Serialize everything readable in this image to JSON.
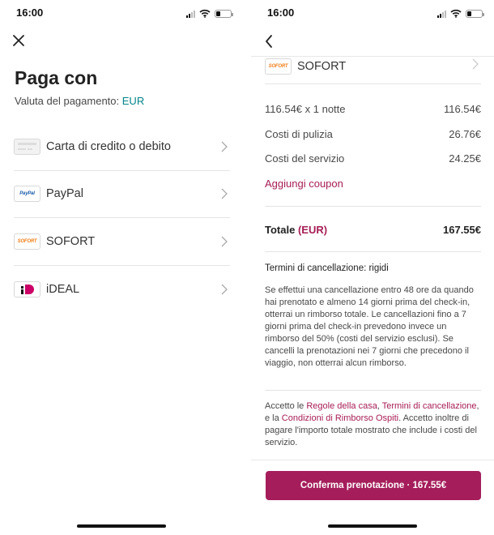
{
  "status_bar": {
    "time": "16:00"
  },
  "left": {
    "title": "Paga con",
    "currency_label": "Valuta del pagamento:",
    "currency": "EUR",
    "methods": [
      {
        "label": "Carta di credito o debito",
        "icon": "credit-card-icon"
      },
      {
        "label": "PayPal",
        "icon": "paypal-logo",
        "logo_text": "PayPal"
      },
      {
        "label": "SOFORT",
        "icon": "sofort-logo",
        "logo_text": "SOFORT"
      },
      {
        "label": "iDEAL",
        "icon": "ideal-logo"
      }
    ]
  },
  "right": {
    "method": {
      "label": "SOFORT",
      "logo_text": "SOFORT"
    },
    "price_rows": [
      {
        "label": "116.54€ x 1 notte",
        "value": "116.54€"
      },
      {
        "label": "Costi di pulizia",
        "value": "26.76€"
      },
      {
        "label": "Costi del servizio",
        "value": "24.25€"
      }
    ],
    "coupon_label": "Aggiungi coupon",
    "total_label": "Totale",
    "total_currency": "(EUR)",
    "total_value": "167.55€",
    "policy_title": "Termini di cancellazione: rigidi",
    "policy_text": "Se effettui una cancellazione entro 48 ore da quando hai prenotato e almeno 14 giorni prima del check-in, otterrai un rimborso totale. Le cancellazioni fino a 7 giorni prima del check-in prevedono invece un rimborso del 50% (costi del servizio esclusi). Se cancelli la prenotazioni nei 7 giorni che precedono il viaggio, non otterrai alcun rimborso.",
    "terms": {
      "t1": "Accetto le ",
      "link1": "Regole della casa",
      "t2": ", ",
      "link2": "Termini di cancellazione",
      "t3": ", e la ",
      "link3": "Condizioni di Rimborso Ospiti",
      "t4": ". Accetto inoltre di pagare l'importo totale mostrato che include i costi del servizio."
    },
    "confirm_label": "Conferma prenotazione · 167.55€"
  },
  "colors": {
    "accent": "#a61d55",
    "teal": "#008489",
    "sofort": "#ef7f1a",
    "paypal": "#1f5fa8",
    "ideal": "#cc0066"
  }
}
